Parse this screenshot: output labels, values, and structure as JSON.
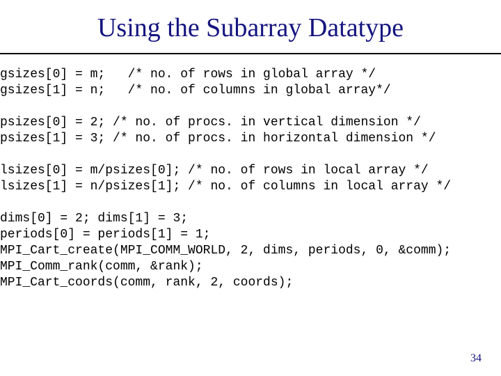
{
  "title": "Using the Subarray Datatype",
  "code_lines": [
    "gsizes[0] = m;   /* no. of rows in global array */",
    "gsizes[1] = n;   /* no. of columns in global array*/",
    "",
    "psizes[0] = 2; /* no. of procs. in vertical dimension */",
    "psizes[1] = 3; /* no. of procs. in horizontal dimension */",
    "",
    "lsizes[0] = m/psizes[0]; /* no. of rows in local array */",
    "lsizes[1] = n/psizes[1]; /* no. of columns in local array */",
    "",
    "dims[0] = 2; dims[1] = 3;",
    "periods[0] = periods[1] = 1;",
    "MPI_Cart_create(MPI_COMM_WORLD, 2, dims, periods, 0, &comm);",
    "MPI_Comm_rank(comm, &rank);",
    "MPI_Cart_coords(comm, rank, 2, coords);"
  ],
  "page_number": "34"
}
